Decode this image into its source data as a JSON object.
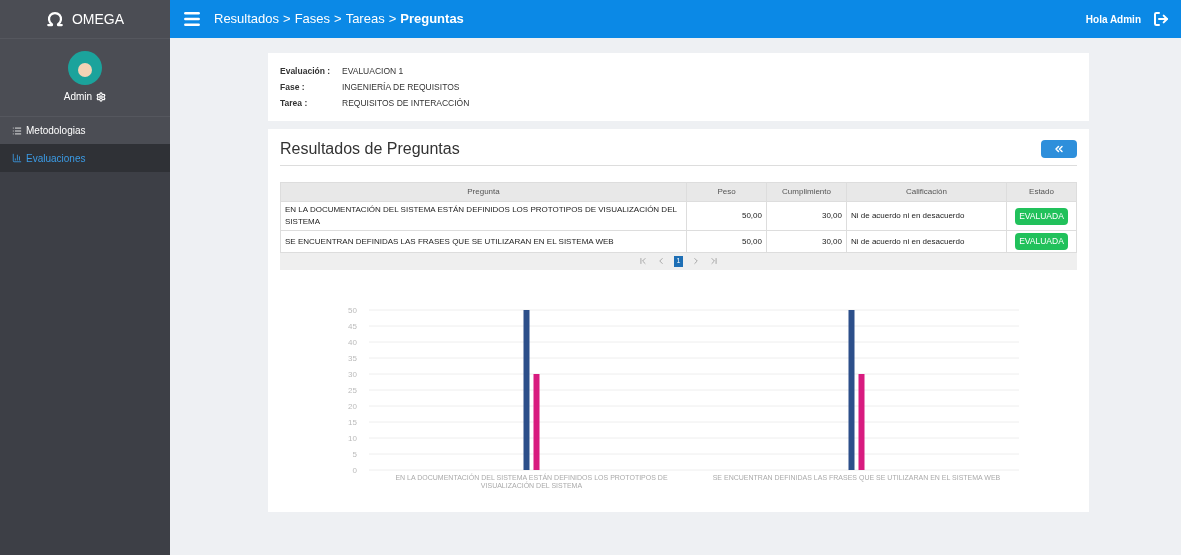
{
  "brand": {
    "name": "OMEGA"
  },
  "user": {
    "name": "Admin"
  },
  "sidebar": {
    "items": [
      {
        "label": "Metodologias",
        "kind": "list",
        "selected": false
      },
      {
        "label": "Evaluaciones",
        "kind": "chart",
        "selected": true
      }
    ]
  },
  "topbar": {
    "breadcrumb": [
      "Resultados",
      ">",
      "Fases",
      ">",
      "Tareas",
      ">",
      "Preguntas"
    ],
    "greeting": "Hola Admin"
  },
  "info": [
    {
      "label": "Evaluación :",
      "value": "EVALUACION 1"
    },
    {
      "label": "Fase :",
      "value": "INGENIERÍA DE REQUISITOS"
    },
    {
      "label": "Tarea :",
      "value": "REQUISITOS DE INTERACCIÓN"
    }
  ],
  "results": {
    "title": "Resultados de Preguntas",
    "table": {
      "columns": [
        "Pregunta",
        "Peso",
        "Cumplimiento",
        "Calificación",
        "Estado"
      ],
      "rows": [
        [
          "EN LA DOCUMENTACIÓN DEL SISTEMA ESTÁN DEFINIDOS LOS PROTOTIPOS DE VISUALIZACIÓN DEL SISTEMA",
          "50,00",
          "30,00",
          "Ni de acuerdo ni en desacuerdo",
          "EVALUADA"
        ],
        [
          "SE ENCUENTRAN DEFINIDAS LAS FRASES QUE SE UTILIZARAN EN EL SISTEMA WEB",
          "50,00",
          "30,00",
          "Ni de acuerdo ni en desacuerdo",
          "EVALUADA"
        ]
      ]
    },
    "pager": {
      "pages": [
        {
          "label": "1",
          "selected": true
        }
      ]
    },
    "chart_data": {
      "type": "bar",
      "categories": [
        "EN LA DOCUMENTACIÓN DEL SISTEMA ESTÁN DEFINIDOS LOS PROTOTIPOS DE VISUALIZACIÓN DEL SISTEMA",
        "SE ENCUENTRAN DEFINIDAS LAS FRASES QUE SE UTILIZARAN EN EL SISTEMA WEB"
      ],
      "series": [
        {
          "color": "#2c4f8a",
          "values": [
            50,
            50
          ]
        },
        {
          "color": "#d81b7f",
          "values": [
            30,
            30
          ]
        }
      ],
      "grid": true,
      "ylim": [
        0,
        50
      ],
      "yticks": [
        0,
        5,
        10,
        15,
        20,
        25,
        30,
        35,
        40,
        45,
        50
      ]
    }
  }
}
